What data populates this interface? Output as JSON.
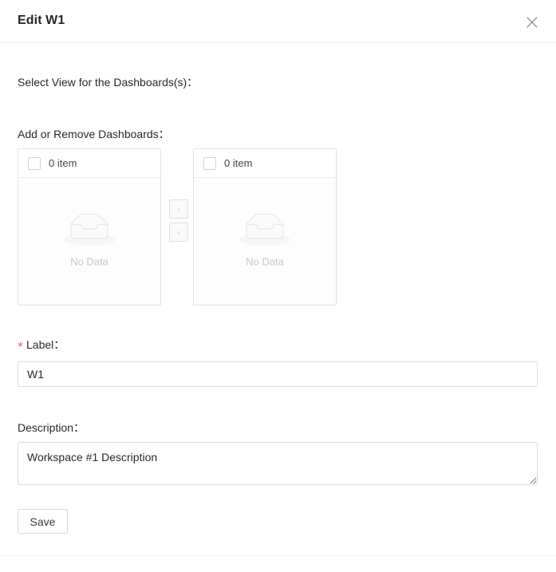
{
  "modal": {
    "title": "Edit W1",
    "close_icon": "close-x-icon"
  },
  "form": {
    "select_view_label": "Select View for the Dashboards(s)：",
    "add_remove_label": "Add or Remove Dashboards：",
    "label_field_label": "Label：",
    "label_required_marker": "*",
    "label_value": "W1",
    "description_field_label": "Description：",
    "description_value": "Workspace #1 Description",
    "save_label": "Save"
  },
  "transfer": {
    "source_panel": {
      "count_text": "0 item",
      "checkbox_checked": false,
      "empty_text": "No Data",
      "empty_icon": "empty-box-icon"
    },
    "target_panel": {
      "count_text": "0 item",
      "checkbox_checked": false,
      "empty_text": "No Data",
      "empty_icon": "empty-box-icon"
    },
    "operations": {
      "to_right_label": "›",
      "to_left_label": "‹",
      "to_right_icon": "chevron-right-icon",
      "to_left_icon": "chevron-left-icon",
      "to_right_disabled": true,
      "to_left_disabled": true
    }
  },
  "colors": {
    "required_marker": "#ff4d4f",
    "border": "#e2e2e2",
    "divider": "#f0f0f0",
    "empty_text": "rgba(0,0,0,0.22)",
    "text_primary": "rgba(0,0,0,0.85)"
  }
}
